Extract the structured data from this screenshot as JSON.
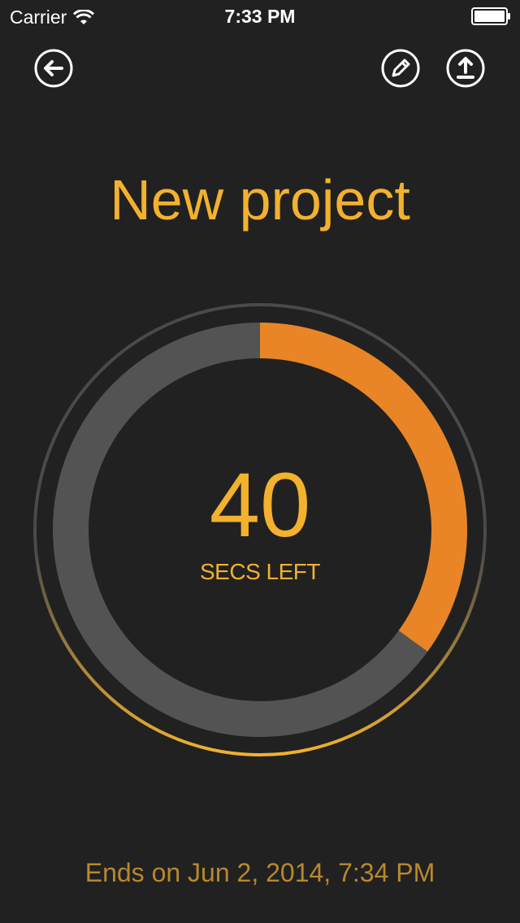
{
  "status_bar": {
    "carrier": "Carrier",
    "time": "7:33 PM",
    "battery_level": 1.0
  },
  "toolbar": {
    "back_icon": "arrow-left-icon",
    "edit_icon": "pencil-icon",
    "share_icon": "upload-icon"
  },
  "project": {
    "title": "New project"
  },
  "timer": {
    "value": "40",
    "unit_label": "SECS LEFT",
    "progress_fraction": 0.35
  },
  "footer": {
    "end_text": "Ends on Jun 2, 2014, 7:34 PM"
  },
  "colors": {
    "background": "#212121",
    "accent": "#f2b12e",
    "progress": "#e98526",
    "track": "#535353",
    "outer_ring": "#4a4a4a",
    "footer_text": "#b8882c"
  }
}
